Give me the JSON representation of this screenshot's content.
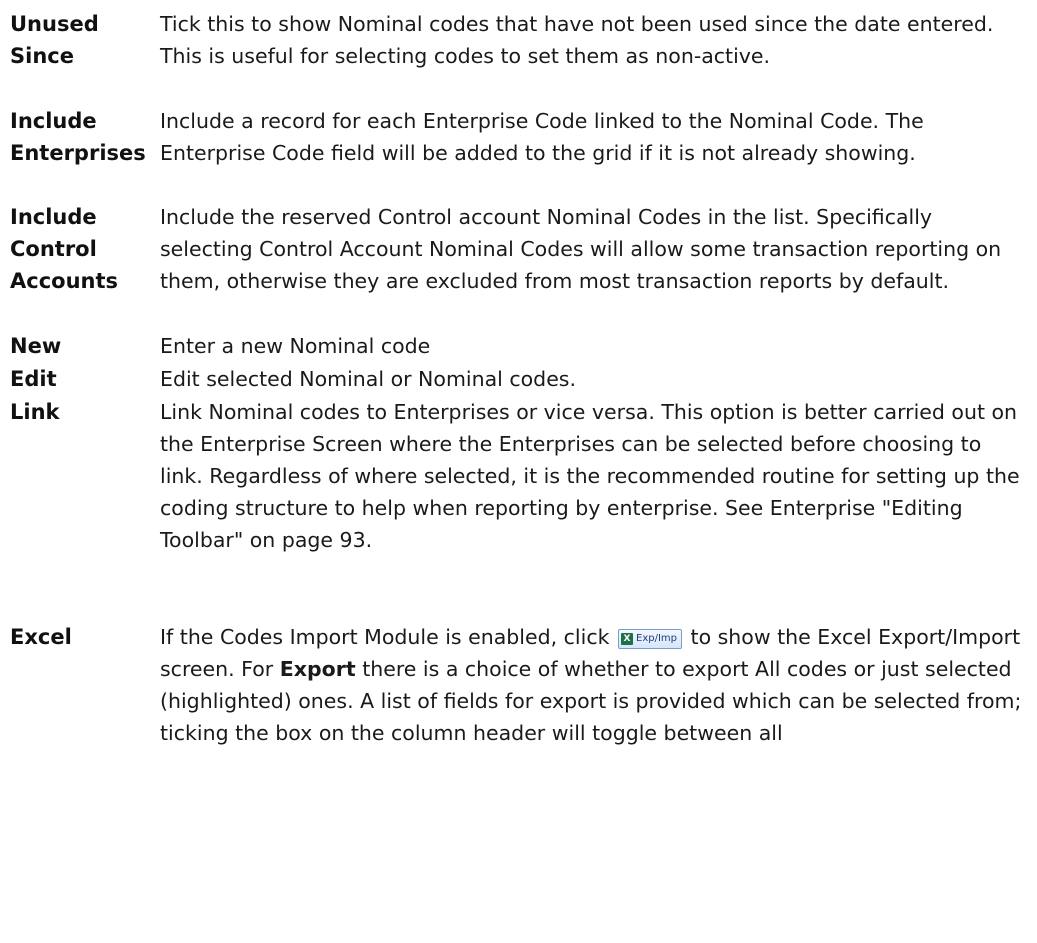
{
  "entries": [
    {
      "term_lines": [
        "Unused",
        "Since"
      ],
      "description": "Tick this to show Nominal codes that have not been used since the date entered.  This is useful for selecting codes to set them as non-active."
    },
    {
      "term_lines": [
        "Include",
        "Enterprises"
      ],
      "description": "Include a record for each Enterprise Code linked to the Nominal Code. The Enterprise Code field will be added to the grid if it is not already showing."
    },
    {
      "term_lines": [
        "Include",
        "Control",
        "Accounts"
      ],
      "description": "Include the reserved Control account Nominal Codes in the list. Specifically selecting Control Account Nominal Codes will allow some transaction reporting on them, otherwise they are excluded from most transaction reports by default."
    },
    {
      "term_lines": [
        "New"
      ],
      "description": "Enter a new Nominal code"
    },
    {
      "term_lines": [
        "Edit"
      ],
      "description": "Edit selected Nominal or Nominal codes."
    },
    {
      "term_lines": [
        "Link"
      ],
      "description": "Link Nominal codes to Enterprises or vice versa. This option is better carried out on the Enterprise Screen where the Enterprises can be selected before choosing to link. Regardless of where selected, it is the recommended routine for setting up the coding structure to help when reporting by enterprise. See Enterprise \"Editing Toolbar\" on page 93."
    },
    {
      "term_lines": [
        "Excel"
      ],
      "description_parts": {
        "p1": "If the Codes Import Module is enabled, click",
        "button_label": "Exp/Imp",
        "button_icon": "excel-icon",
        "p2": "to show the Excel Export/Import screen.  For",
        "bold_export": "Export",
        "p3": "there is a choice of whether to export All codes or just selected (highlighted) ones. A list of fields for export is provided which can be selected from; ticking the box on the column header will toggle between all"
      }
    }
  ],
  "colors": {
    "text": "#1a1a1a",
    "button_border": "#7a9cc8",
    "excel_green": "#1e7145"
  }
}
